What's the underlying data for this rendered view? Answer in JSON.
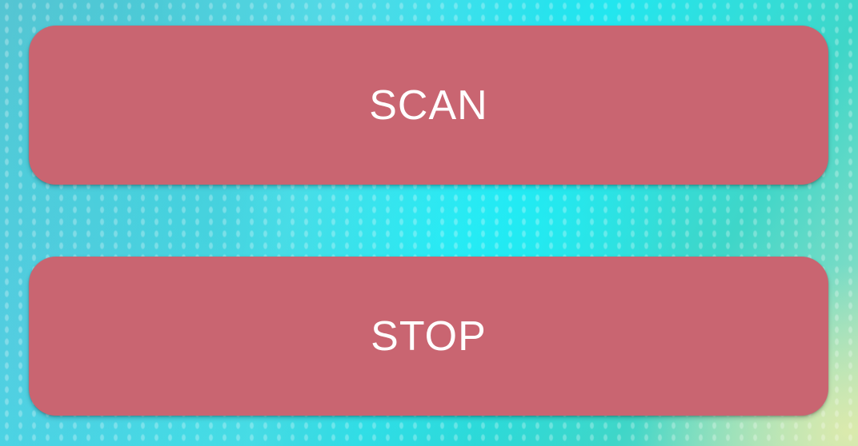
{
  "buttons": {
    "scan_label": "SCAN",
    "stop_label": "STOP"
  },
  "colors": {
    "button_background": "#c96571",
    "button_text": "#ffffff",
    "background_accent": "#22e6ef"
  }
}
